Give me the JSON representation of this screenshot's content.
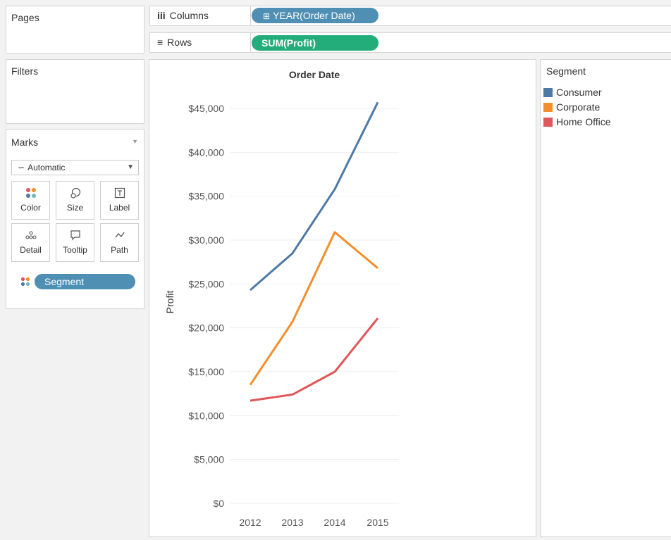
{
  "pages": {
    "title": "Pages"
  },
  "filters": {
    "title": "Filters"
  },
  "marks": {
    "title": "Marks",
    "mark_type": "Automatic",
    "buttons": [
      {
        "label": "Color",
        "icon": "color-icon"
      },
      {
        "label": "Size",
        "icon": "size-icon"
      },
      {
        "label": "Label",
        "icon": "label-icon"
      },
      {
        "label": "Detail",
        "icon": "detail-icon"
      },
      {
        "label": "Tooltip",
        "icon": "tooltip-icon"
      },
      {
        "label": "Path",
        "icon": "path-icon"
      }
    ],
    "color_field": "Segment"
  },
  "columns": {
    "label": "Columns",
    "pill": "YEAR(Order Date)",
    "pill_color": "#4f8fb3"
  },
  "rows": {
    "label": "Rows",
    "pill": "SUM(Profit)",
    "pill_color": "#22ad7a"
  },
  "legend": {
    "title": "Segment",
    "items": [
      {
        "label": "Consumer",
        "color": "#4e79a7"
      },
      {
        "label": "Corporate",
        "color": "#f28e2b"
      },
      {
        "label": "Home Office",
        "color": "#e15759"
      }
    ]
  },
  "chart_data": {
    "type": "line",
    "title": "Order Date",
    "xlabel": "",
    "ylabel": "Profit",
    "categories": [
      "2012",
      "2013",
      "2014",
      "2015"
    ],
    "series": [
      {
        "name": "Consumer",
        "color": "#4e79a7",
        "values": [
          24300,
          28500,
          35800,
          45700
        ]
      },
      {
        "name": "Corporate",
        "color": "#f28e2b",
        "values": [
          13500,
          20700,
          30900,
          26800
        ]
      },
      {
        "name": "Home Office",
        "color": "#e15759",
        "values": [
          11700,
          12400,
          15000,
          21100
        ]
      }
    ],
    "ylim": [
      0,
      45000
    ],
    "yticks": [
      "$0",
      "$5,000",
      "$10,000",
      "$15,000",
      "$20,000",
      "$25,000",
      "$30,000",
      "$35,000",
      "$40,000",
      "$45,000"
    ],
    "grid": true,
    "legend": "right"
  }
}
